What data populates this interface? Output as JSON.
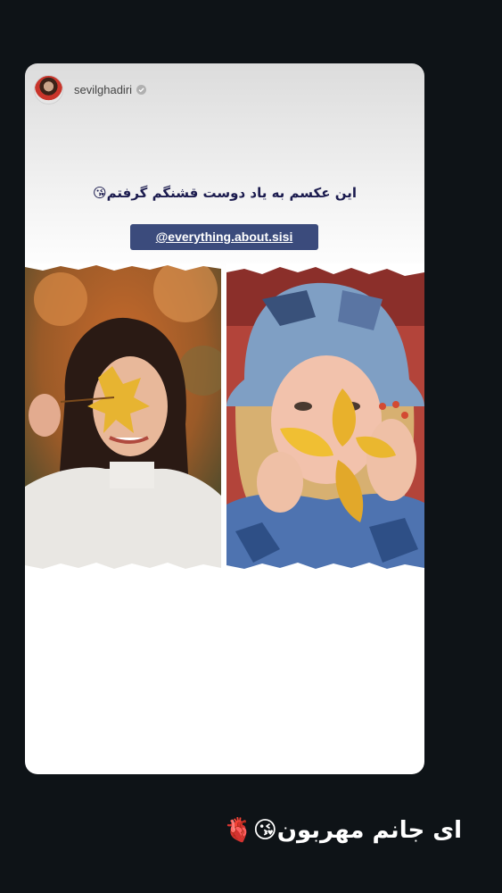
{
  "story": {
    "username": "sevilghadiri",
    "verified": true,
    "caption": "این عکسم به یاد دوست قشنگم گرفتم😘",
    "mention": "@everything.about.sisi",
    "photos": [
      {
        "description": "woman in white sweater holding autumn leaf",
        "icon": "photo-left"
      },
      {
        "description": "woman in denim hat holding yellow leaves",
        "icon": "photo-right"
      }
    ]
  },
  "message": {
    "text": "ای جانم مهربون😘🫀"
  },
  "colors": {
    "background": "#0e1317",
    "mention_bg": "#3b4b7c",
    "caption_text": "#1b1b4e"
  }
}
